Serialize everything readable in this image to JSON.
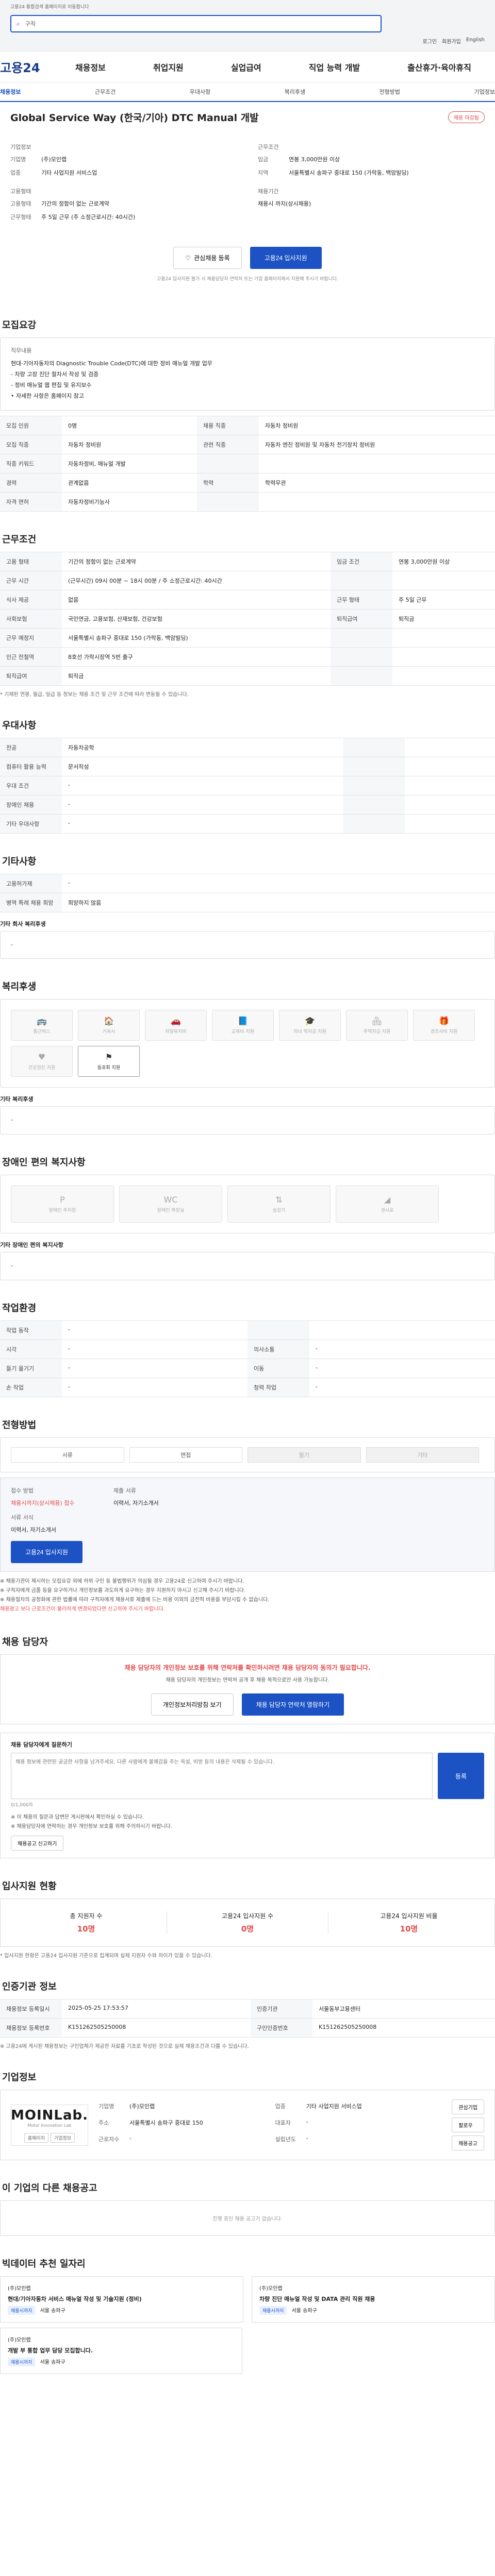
{
  "top": {
    "notice": "고용24 통합검색 홈페이지로 이동합니다",
    "search_value": "구직",
    "util": [
      "로그인",
      "회원가입",
      "English"
    ]
  },
  "brand": "고용24",
  "nav": [
    "채용정보",
    "취업지원",
    "실업급여",
    "직업 능력 개발",
    "출산휴가·육아휴직"
  ],
  "subnav": [
    {
      "label": "채용정보",
      "active": true
    },
    {
      "label": "근무조건",
      "active": false
    },
    {
      "label": "우대사항",
      "active": false
    },
    {
      "label": "복리후생",
      "active": false
    },
    {
      "label": "전형방법",
      "active": false
    },
    {
      "label": "기업정보",
      "active": false
    }
  ],
  "job": {
    "title": "Global Service Way (한국/기아) DTC Manual 개발",
    "status_badge": "채용 마감됨",
    "company_label": "기업정보",
    "company_rows": [
      {
        "k": "기업명",
        "v": "(주)모인랩"
      },
      {
        "k": "업종",
        "v": "기타 사업지원 서비스업"
      }
    ],
    "cond_label": "근무조건",
    "cond_rows": [
      {
        "k": "임금",
        "v": "연봉 3,000만원 이상"
      },
      {
        "k": "지역",
        "v": "서울특별시 송파구 중대로 150 (가락동, 백암빌딩)"
      }
    ],
    "emp_label": "고용형태",
    "emp_rows": [
      {
        "k": "고용형태",
        "v": "기간의 정함이 없는 근로계약"
      },
      {
        "k": "근무형태",
        "v": "주 5일 근무 (주 소정근로시간: 40시간)"
      }
    ],
    "career_label": "채용기간",
    "career_rows": [
      {
        "k": "",
        "v": "채용시 까지(상시채용)"
      }
    ]
  },
  "buttons": {
    "favorite": "관심채용 등록",
    "apply": "고용24 입사지원",
    "note": "고용24 입사지원 불가 시 채용담당자 연락처 또는 기업 홈페이지에서 지원해 주시기 바랍니다."
  },
  "recruit_section": {
    "title": "모집요강",
    "desc_title": "직무내용",
    "desc_lines": [
      "현대·기아자동차의 Diagnostic Trouble Code(DTC)에 대한 정비 매뉴얼 개발 업무",
      "- 차량 고장 진단 절차서 작성 및 검증",
      "- 정비 매뉴얼 웹 편집 및 유지보수",
      "• 자세한 사항은 홈페이지 참고"
    ],
    "rows": [
      [
        {
          "h": "모집 인원",
          "v": "0명"
        },
        {
          "h": "채용 직종",
          "v": "자동차 정비원"
        }
      ],
      [
        {
          "h": "모집 직종",
          "v": "자동차 정비원"
        },
        {
          "h": "관련 직종",
          "v": "자동차 엔진 정비원 및 자동차 전기장치 정비원"
        }
      ],
      [
        {
          "h": "직종 키워드",
          "v": "자동차정비, 매뉴얼 개발"
        },
        {
          "h": "",
          "v": ""
        }
      ],
      [
        {
          "h": "경력",
          "v": "관계없음"
        },
        {
          "h": "학력",
          "v": "학력무관"
        }
      ],
      [
        {
          "h": "자격 면허",
          "v": "자동차정비기능사"
        },
        {
          "h": "",
          "v": ""
        }
      ]
    ]
  },
  "work_section": {
    "title": "근무조건",
    "rows": [
      [
        {
          "h": "고용 형태",
          "v": "기간의 정함이 없는 근로계약"
        },
        {
          "h": "임금 조건",
          "v": "연봉 3,000만원 이상"
        }
      ],
      [
        {
          "h": "근무 시간",
          "v": "(근무시간) 09시 00분 ~ 18시 00분 / 주 소정근로시간: 40시간"
        },
        {
          "h": "",
          "v": ""
        }
      ],
      [
        {
          "h": "식사 제공",
          "v": "없음"
        },
        {
          "h": "근무 형태",
          "v": "주 5일 근무"
        }
      ],
      [
        {
          "h": "사회보험",
          "v": "국민연금, 고용보험, 산재보험, 건강보험"
        },
        {
          "h": "퇴직급여",
          "v": "퇴직금"
        }
      ],
      [
        {
          "h": "근무 예정지",
          "v": "서울특별시 송파구 중대로 150 (가락동, 백암빌딩)"
        },
        {
          "h": "",
          "v": ""
        }
      ],
      [
        {
          "h": "인근 전철역",
          "v": "8호선 가락시장역 5번 출구"
        },
        {
          "h": "",
          "v": ""
        }
      ],
      [
        {
          "h": "퇴직급여",
          "v": "퇴직금"
        },
        {
          "h": "",
          "v": ""
        }
      ]
    ],
    "note": "* 기재된 연봉, 월급, 일급 등 정보는 채용 조건 및 근무 조건에 따라 변동될 수 있습니다."
  },
  "prefer_section": {
    "title": "우대사항",
    "rows": [
      [
        {
          "h": "전공",
          "v": "자동차공학"
        },
        {
          "h": "",
          "v": ""
        }
      ],
      [
        {
          "h": "컴퓨터 활용 능력",
          "v": "문서작성"
        },
        {
          "h": "",
          "v": ""
        }
      ],
      [
        {
          "h": "우대 조건",
          "v": "-"
        },
        {
          "h": "",
          "v": ""
        }
      ],
      [
        {
          "h": "장애인 채용",
          "v": "-"
        },
        {
          "h": "",
          "v": ""
        }
      ],
      [
        {
          "h": "기타 우대사항",
          "v": "-"
        },
        {
          "h": "",
          "v": ""
        }
      ]
    ]
  },
  "other_section": {
    "title": "기타사항",
    "rows": [
      [
        {
          "h": "고용허가제",
          "v": "-"
        }
      ],
      [
        {
          "h": "병역 특례 채용 희망",
          "v": "희망하지 않음"
        }
      ]
    ],
    "detail_title": "기타 회사 복리후생",
    "detail_value": "-"
  },
  "welfare_section": {
    "title": "복리후생",
    "icons": [
      {
        "label": "통근버스",
        "icon": "bus",
        "on": false
      },
      {
        "label": "기숙사",
        "icon": "house",
        "on": false
      },
      {
        "label": "차량유지비",
        "icon": "car",
        "on": false
      },
      {
        "label": "교육비 지원",
        "icon": "book",
        "on": false
      },
      {
        "label": "자녀 학자금 지원",
        "icon": "cap",
        "on": false
      },
      {
        "label": "주택자금 지원",
        "icon": "home",
        "on": false
      },
      {
        "label": "경조사비 지원",
        "icon": "gift",
        "on": false
      },
      {
        "label": "건강검진 지원",
        "icon": "heart",
        "on": false
      },
      {
        "label": "동호회 지원",
        "icon": "group",
        "on": true
      }
    ],
    "etc_title": "기타 복리후생",
    "etc_value": "-"
  },
  "disabled_section": {
    "title": "장애인 편의 복지사항",
    "icons": [
      {
        "label": "장애인 주차장",
        "icon": "parking"
      },
      {
        "label": "장애인 화장실",
        "icon": "toilet"
      },
      {
        "label": "승강기",
        "icon": "elevator"
      },
      {
        "label": "경사로",
        "icon": "ramp"
      }
    ],
    "etc_title": "기타 장애인 편의 복지사항",
    "etc_value": "-"
  },
  "env_section": {
    "title": "작업환경",
    "rows": [
      [
        {
          "h": "작업 동작",
          "v": "-"
        },
        {
          "h": "",
          "v": ""
        }
      ],
      [
        {
          "h": "시각",
          "v": "-"
        },
        {
          "h": "의사소통",
          "v": "-"
        }
      ],
      [
        {
          "h": "들기 옮기기",
          "v": "-"
        },
        {
          "h": "이동",
          "v": "-"
        }
      ],
      [
        {
          "h": "손 작업",
          "v": "-"
        },
        {
          "h": "청력 작업",
          "v": "-"
        }
      ]
    ]
  },
  "process_section": {
    "title": "전형방법",
    "steps": [
      {
        "label": "서류",
        "on": true
      },
      {
        "label": "면접",
        "on": true
      },
      {
        "label": "필기",
        "on": false
      },
      {
        "label": "기타",
        "on": false
      }
    ],
    "apply": {
      "how_label": "접수 방법",
      "how_value": "채용시까지(상시채용) 접수",
      "doc_label": "제출 서류",
      "doc_value": "이력서, 자기소개서",
      "form_label": "서류 서식",
      "form_value": "이력서, 자기소개서",
      "apply_btn": "고용24 입사지원"
    },
    "warnings": [
      "※ 채용기관이 제시하는 모집요강 외에 허위 구인 등 불법행위가 의심될 경우 고용24로 신고하여 주시기 바랍니다.",
      "※ 구직자에게 금품 등을 요구하거나 개인정보를 과도하게 요구하는 경우 지원하지 마시고 신고해 주시기 바랍니다.",
      "※ 채용절차의 공정화에 관한 법률에 따라 구직자에게 채용서류 제출에 드는 비용 이외의 금전적 비용을 부담시킬 수 없습니다."
    ],
    "warn_red": "채용광고 보다 근로조건이 불리하게 변경되었다면 신고하여 주시기 바랍니다."
  },
  "contact_section": {
    "title": "채용 담당자",
    "alert": "채용 담당자의 개인정보 보호를 위해 연락처를 확인하시려면 채용 담당자의 동의가 필요합니다.",
    "desc": "채용 담당자의 개인정보는 연락처 공개 후 채용 목적으로만 사용 가능합니다.",
    "btn1": "개인정보처리방침 보기",
    "btn2": "채용 담당자 연락처 열람하기",
    "qa_title": "채용 담당자에게 질문하기",
    "qa_hint": "0/1,000자",
    "qa_placeholder": "채용 정보에 관련된 궁금한 사항을 남겨주세요. 다른 사람에게 불쾌감을 주는 욕설, 비방 등의 내용은 삭제될 수 있습니다.",
    "qa_btn": "등록",
    "notes": [
      "※ 이 채용의 질문과 답변은 게시판에서 확인하실 수 있습니다.",
      "※ 채용담당자에 연락하는 경우 개인정보 보호를 위해 주의하시기 바랍니다."
    ],
    "report_btn": "채용공고 신고하기"
  },
  "stats_section": {
    "title": "입사지원 현황",
    "link": "더보기",
    "items": [
      {
        "label": "총 지원자 수",
        "value": "10명"
      },
      {
        "label": "고용24 입사지원 수",
        "value": "0명"
      },
      {
        "label": "고용24 입사지원 비율",
        "value": "10명"
      }
    ],
    "note": "* 입사지원 현황은 고용24 입사지원 기준으로 집계되며 실제 지원자 수와 차이가 있을 수 있습니다."
  },
  "agency_section": {
    "title": "인증기관 정보",
    "btn": "기관 정보",
    "rows": [
      [
        {
          "h": "채용정보 등록일시",
          "v": "2025-05-25 17:53:57"
        },
        {
          "h": "인증기관",
          "v": "서울동부고용센터"
        }
      ],
      [
        {
          "h": "채용정보 등록번호",
          "v": "K151262505250008"
        },
        {
          "h": "구인인증번호",
          "v": "K151262505250008"
        }
      ]
    ],
    "note": "※ 고용24에 게시된 채용정보는 구인업체가 제공한 자료를 기초로 작성된 것으로 실제 채용조건과 다를 수 있습니다."
  },
  "company_section": {
    "title": "기업정보",
    "logo": "MOINLab.",
    "logo_sub": "Motor Innovation Lab",
    "btn_home": "홈페이지",
    "btn_info": "기업정보",
    "fields": [
      {
        "k": "기업명",
        "v": "(주)모인랩"
      },
      {
        "k": "업종",
        "v": "기타 사업지원 서비스업"
      },
      {
        "k": "주소",
        "v": "서울특별시 송파구 중대로 150"
      },
      {
        "k": "대표자",
        "v": "-"
      },
      {
        "k": "근로자수",
        "v": "-"
      },
      {
        "k": "설립년도",
        "v": "-"
      }
    ],
    "btns": [
      "관심기업",
      "팔로우",
      "채용공고"
    ]
  },
  "similar_section": {
    "title": "이 기업의 다른 채용공고",
    "empty": "진행 중인 채용 공고가 없습니다."
  },
  "recommend_section": {
    "title": "빅데이터 추천 일자리",
    "cards": [
      {
        "co": "(주)모인랩",
        "title": "현대/기아자동차 서비스 매뉴얼 작성 및 기술지원 (정비)",
        "chip": "채용시까지",
        "loc": "서울 송파구"
      },
      {
        "co": "(주)모인랩",
        "title": "차량 진단 매뉴얼 작성 및 DATA 관리 직원 채용",
        "chip": "채용시까지",
        "loc": "서울 송파구"
      }
    ],
    "card3": {
      "co": "(주)모인랩",
      "title": "개발 부 통합 업무 담당 모집합니다.",
      "chip": "채용시까지",
      "loc": "서울 송파구"
    }
  }
}
